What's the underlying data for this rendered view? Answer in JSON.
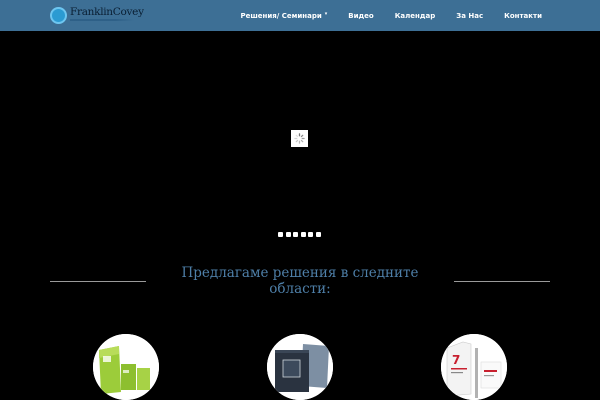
{
  "header": {
    "logo_text": "FranklinCovey",
    "nav": [
      {
        "label": "Решения/ Семинари",
        "has_dropdown": true
      },
      {
        "label": "Видео"
      },
      {
        "label": "Календар"
      },
      {
        "label": "За Нас"
      },
      {
        "label": "Контакти"
      }
    ],
    "background_color": "#3d6f95"
  },
  "slider": {
    "loader_icon": "spinner-icon",
    "slide_count": 6
  },
  "section": {
    "heading": "Предлагаме решения в следните области:",
    "heading_color": "#4e7fa8"
  },
  "solutions": [
    {
      "image": "green-books-image",
      "accent_color": "#8dbf2f"
    },
    {
      "image": "dark-books-image",
      "accent_color": "#2a3340"
    },
    {
      "image": "7-habits-book-image",
      "accent_color": "#c8202f"
    }
  ]
}
